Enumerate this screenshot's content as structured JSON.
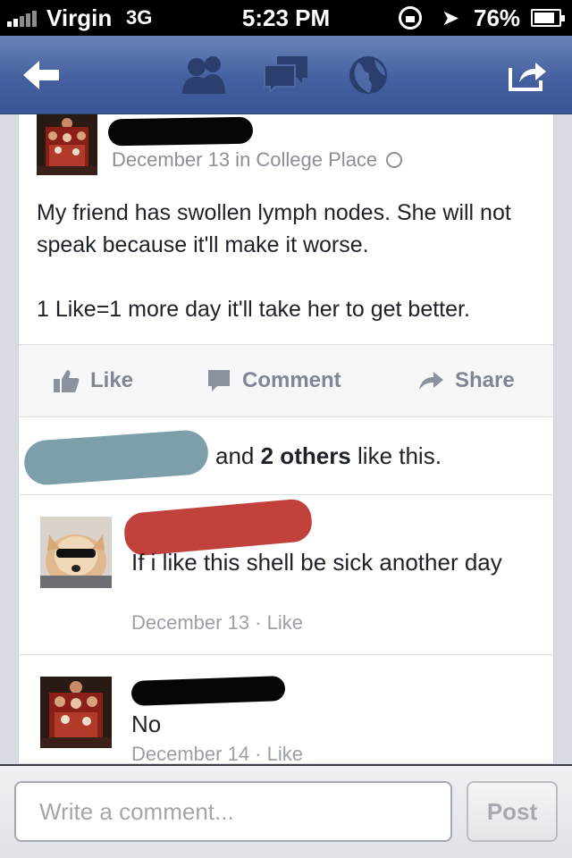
{
  "status_bar": {
    "carrier": "Virgin",
    "network": "3G",
    "time": "5:23 PM",
    "battery": "76%"
  },
  "navbar": {
    "icons": [
      "back-arrow-icon",
      "friends-icon",
      "messages-icon",
      "globe-icon",
      "share-icon"
    ]
  },
  "post": {
    "meta": "December 13 in College Place",
    "text_line1": "My friend has swollen lymph nodes. She will not speak because it'll make it worse.",
    "text_line2": "1 Like=1 more day it'll take her to get better."
  },
  "actions": {
    "like": "Like",
    "comment": "Comment",
    "share": "Share"
  },
  "likes": {
    "prefix": "and",
    "count_label": "2 others",
    "suffix": "like this."
  },
  "comments": [
    {
      "text": "If i like this shell be sick another day",
      "meta": "December 13 · Like"
    },
    {
      "text": "No",
      "meta": "December 14 · Like"
    }
  ],
  "compose": {
    "placeholder": "Write a comment...",
    "post_label": "Post"
  },
  "colors": {
    "nav_blue": "#4460a0",
    "text": "#1d2129",
    "muted": "#8a8f99",
    "redact_teal": "#7c9fa9",
    "redact_red": "#c1413c"
  }
}
